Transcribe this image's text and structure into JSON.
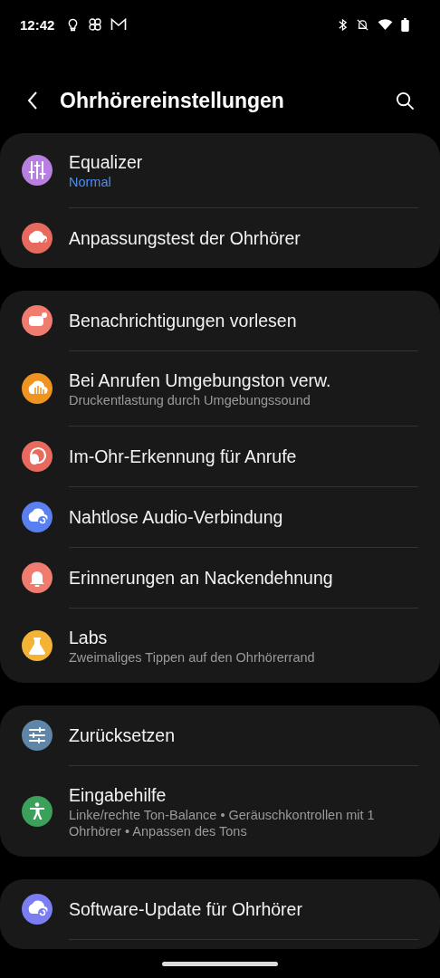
{
  "status_bar": {
    "time": "12:42"
  },
  "header": {
    "title": "Ohrhörereinstellungen"
  },
  "groups": [
    {
      "items": [
        {
          "kind": "equalizer",
          "color": "#b77fe0",
          "title": "Equalizer",
          "subtitle": "Normal",
          "subtitle_accent": true
        },
        {
          "kind": "earcheck",
          "color": "#e8695e",
          "title": "Anpassungstest der Ohrhörer"
        }
      ]
    },
    {
      "items": [
        {
          "kind": "message",
          "color": "#f07c70",
          "title": "Benachrichtigungen vorlesen"
        },
        {
          "kind": "ambient",
          "color": "#ef9420",
          "title": "Bei Anrufen Umgebungston verw.",
          "subtitle": "Druckentlastung durch Umgebungssound",
          "subtitle_accent": false
        },
        {
          "kind": "ear",
          "color": "#e8695e",
          "title": "Im-Ohr-Erkennung für Anrufe"
        },
        {
          "kind": "cloudsync",
          "color": "#5a7ff0",
          "title": "Nahtlose Audio-Verbindung"
        },
        {
          "kind": "bell",
          "color": "#f07c70",
          "title": "Erinnerungen an Nackendehnung"
        },
        {
          "kind": "flask",
          "color": "#f5b335",
          "title": "Labs",
          "subtitle": "Zweimaliges Tippen auf den Ohrhörerrand",
          "subtitle_accent": false
        }
      ]
    },
    {
      "items": [
        {
          "kind": "sliders",
          "color": "#5f86a8",
          "title": "Zurücksetzen"
        },
        {
          "kind": "accessibility",
          "color": "#3aa05a",
          "title": "Eingabehilfe",
          "subtitle": "Linke/rechte Ton-Balance  •  Geräuschkontrollen mit 1 Ohrhörer  •  Anpassen des Tons",
          "subtitle_accent": false
        }
      ]
    },
    {
      "items": [
        {
          "kind": "update",
          "color": "#7b7ef2",
          "title": "Software-Update für Ohrhörer"
        }
      ],
      "continues": true
    }
  ]
}
